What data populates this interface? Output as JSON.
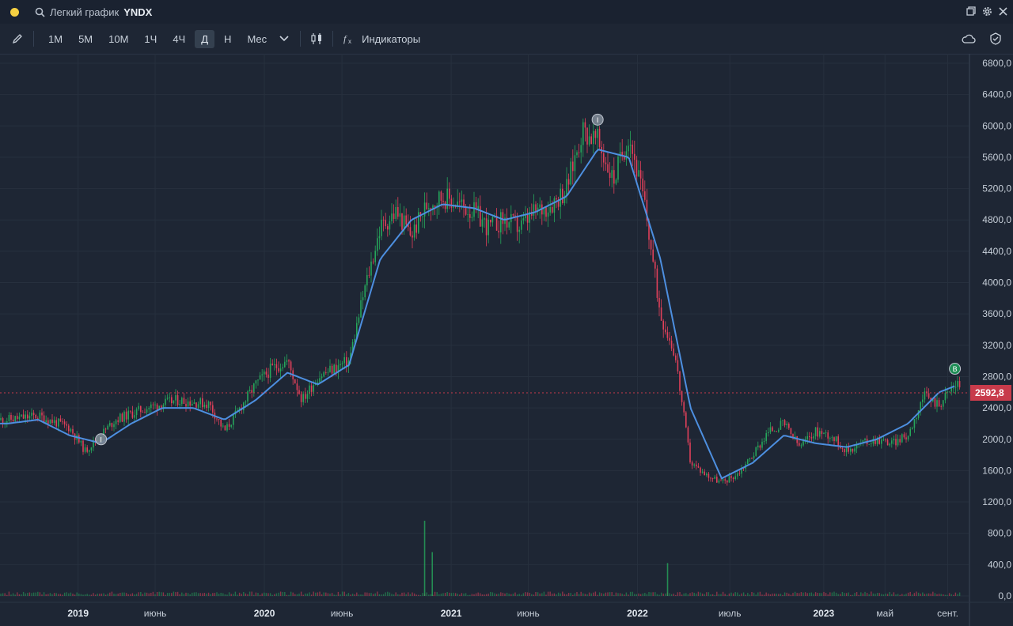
{
  "window": {
    "title_prefix": "Легкий график",
    "ticker": "YNDX",
    "status_dot_color": "#f5d042",
    "controls": [
      "restore-icon",
      "gear-icon",
      "close-icon"
    ]
  },
  "toolbar": {
    "draw_icon": "pencil-icon",
    "timeframes": [
      "1М",
      "5М",
      "10М",
      "1Ч",
      "4Ч",
      "Д",
      "Н",
      "Мес"
    ],
    "active_timeframe": "Д",
    "chart_type_icon": "candles-icon",
    "indicators_label": "Индикаторы",
    "right_icons": [
      "cloud-icon",
      "shield-icon"
    ]
  },
  "chart_data": {
    "type": "candlestick",
    "symbol": "YNDX",
    "y_ticks": [
      "6800,0",
      "6400,0",
      "6000,0",
      "5600,0",
      "5200,0",
      "4800,0",
      "4400,0",
      "4000,0",
      "3600,0",
      "3200,0",
      "2800,0",
      "2400,0",
      "2000,0",
      "1600,0",
      "1200,0",
      "800,0",
      "400,0",
      "0,0"
    ],
    "ylim": [
      0,
      6800
    ],
    "x_ticks": [
      {
        "label": "2019",
        "date": "2019-01",
        "major": true
      },
      {
        "label": "июнь",
        "date": "2019-06",
        "major": false
      },
      {
        "label": "2020",
        "date": "2020-01",
        "major": true
      },
      {
        "label": "июнь",
        "date": "2020-06",
        "major": false
      },
      {
        "label": "2021",
        "date": "2021-01",
        "major": true
      },
      {
        "label": "июнь",
        "date": "2021-06",
        "major": false
      },
      {
        "label": "2022",
        "date": "2022-01",
        "major": true
      },
      {
        "label": "июль",
        "date": "2022-07",
        "major": false
      },
      {
        "label": "2023",
        "date": "2023-01",
        "major": true
      },
      {
        "label": "май",
        "date": "2023-05",
        "major": false
      },
      {
        "label": "сент.",
        "date": "2023-09",
        "major": false
      }
    ],
    "last_price": 2592.8,
    "last_price_label": "2592,8",
    "colors": {
      "up": "#26a65b",
      "down": "#e0405a",
      "ma": "#4d8fe0",
      "last": "#c83b4b"
    },
    "price_series": {
      "name": "Close",
      "x": [
        "2018-08",
        "2018-10",
        "2018-12",
        "2019-01",
        "2019-03",
        "2019-05",
        "2019-07",
        "2019-09",
        "2019-10",
        "2019-12",
        "2020-01",
        "2020-02",
        "2020-03",
        "2020-04",
        "2020-06",
        "2020-07",
        "2020-08",
        "2020-09",
        "2020-10",
        "2020-11",
        "2020-12",
        "2021-01",
        "2021-02",
        "2021-03",
        "2021-04",
        "2021-05",
        "2021-06",
        "2021-07",
        "2021-08",
        "2021-09",
        "2021-10",
        "2021-11",
        "2021-12",
        "2022-01",
        "2022-02",
        "2022-03",
        "2022-04",
        "2022-05",
        "2022-06",
        "2022-07",
        "2022-08",
        "2022-09",
        "2022-10",
        "2022-11",
        "2022-12",
        "2023-01",
        "2023-02",
        "2023-03",
        "2023-04",
        "2023-05",
        "2023-06",
        "2023-07",
        "2023-08",
        "2023-09"
      ],
      "values": [
        2250,
        2300,
        2150,
        1850,
        2250,
        2400,
        2500,
        2450,
        2100,
        2700,
        2900,
        3000,
        2500,
        2800,
        3000,
        3900,
        4700,
        4900,
        4600,
        5000,
        5100,
        5000,
        4900,
        4700,
        4800,
        4700,
        4900,
        5000,
        5200,
        5950,
        5800,
        5300,
        5900,
        5000,
        3600,
        3100,
        1700,
        1550,
        1450,
        1550,
        1800,
        2100,
        2200,
        1900,
        2100,
        2050,
        1850,
        1950,
        2000,
        1950,
        2050,
        2550,
        2450,
        2700
      ]
    },
    "ma_series": {
      "name": "MA",
      "x": [
        "2018-08",
        "2018-10",
        "2018-12",
        "2019-02",
        "2019-04",
        "2019-06",
        "2019-08",
        "2019-10",
        "2019-12",
        "2020-02",
        "2020-04",
        "2020-06",
        "2020-08",
        "2020-10",
        "2020-12",
        "2021-02",
        "2021-04",
        "2021-06",
        "2021-08",
        "2021-10",
        "2021-12",
        "2022-02",
        "2022-04",
        "2022-06",
        "2022-08",
        "2022-10",
        "2022-12",
        "2023-02",
        "2023-04",
        "2023-06",
        "2023-08",
        "2023-09"
      ],
      "values": [
        2200,
        2250,
        2050,
        1950,
        2200,
        2400,
        2400,
        2250,
        2500,
        2850,
        2700,
        2950,
        4300,
        4800,
        5000,
        4950,
        4800,
        4900,
        5100,
        5700,
        5600,
        4300,
        2400,
        1500,
        1700,
        2050,
        1950,
        1900,
        2000,
        2200,
        2600,
        2680
      ]
    },
    "volume_series": {
      "name": "Volume",
      "spikes": [
        {
          "date": "2020-11-10",
          "value": 960
        },
        {
          "date": "2020-11-25",
          "value": 560
        },
        {
          "date": "2022-03-01",
          "value": 420
        }
      ],
      "typical": 40
    },
    "markers": [
      {
        "date": "2019-02",
        "price": 2000,
        "label": "I",
        "color": "#7d8794"
      },
      {
        "date": "2021-10",
        "price": 6080,
        "label": "I",
        "color": "#7d8794"
      },
      {
        "date": "2023-09",
        "price": 2900,
        "label": "B",
        "color": "#1f9a5a"
      }
    ]
  }
}
